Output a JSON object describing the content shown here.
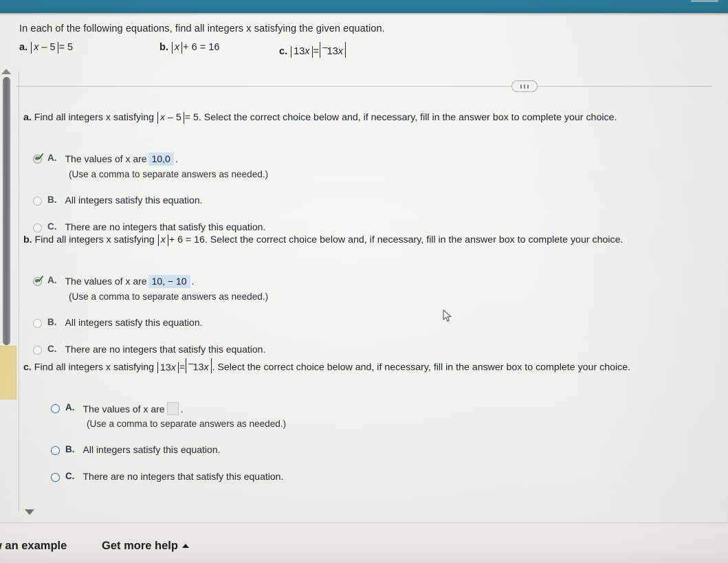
{
  "colors": {
    "header_teal": "#2b7c99",
    "answer_highlight": "#cfe0ee",
    "active_radio_blue": "#3b6ea8",
    "check_green": "#2e7d32",
    "sticky_note": "#e8d79a"
  },
  "prompt": "In each of the following equations, find all integers x satisfying the given equation.",
  "equation_list": [
    {
      "label": "a.",
      "expr": "|x − 5| = 5"
    },
    {
      "label": "b.",
      "expr": "|x| + 6 = 16"
    },
    {
      "label": "c.",
      "expr": "|13x| = |⁻13x|"
    }
  ],
  "divider": {
    "dots_label": "..."
  },
  "parts": [
    {
      "id": "part-a",
      "label": "a.",
      "question": "Find all integers x satisfying |x − 5| = 5. Select the correct choice below and, if necessary, fill in the answer box to complete your choice.",
      "state": "answered",
      "selected": "A",
      "choices": [
        {
          "letter": "A.",
          "text": "The values of x are",
          "answer_value": "10,0",
          "trailing": ".",
          "has_input": true,
          "selected": true,
          "checked": true
        },
        {
          "letter": "B.",
          "text": "All integers satisfy this equation.",
          "has_input": false,
          "selected": false,
          "checked": false
        },
        {
          "letter": "C.",
          "text": "There are no integers that satisfy this equation.",
          "has_input": false,
          "selected": false,
          "checked": false
        }
      ],
      "note": "(Use a comma to separate answers as needed.)"
    },
    {
      "id": "part-b",
      "label": "b.",
      "question": "Find all integers x satisfying |x| + 6 = 16. Select the correct choice below and, if necessary, fill in the answer box to complete your choice.",
      "state": "answered",
      "selected": "A",
      "choices": [
        {
          "letter": "A.",
          "text": "The values of x are",
          "answer_value": "10, − 10",
          "trailing": ".",
          "has_input": true,
          "selected": true,
          "checked": true
        },
        {
          "letter": "B.",
          "text": "All integers satisfy this equation.",
          "has_input": false,
          "selected": false,
          "checked": false
        },
        {
          "letter": "C.",
          "text": "There are no integers that satisfy this equation.",
          "has_input": false,
          "selected": false,
          "checked": false
        }
      ],
      "note": "(Use a comma to separate answers as needed.)"
    },
    {
      "id": "part-c",
      "label": "c.",
      "question": "Find all integers x satisfying |13x| = |⁻13x|. Select the correct choice below and, if necessary, fill in the answer box to complete your choice.",
      "state": "active",
      "selected": null,
      "choices": [
        {
          "letter": "A.",
          "text": "The values of x are",
          "answer_value": "",
          "trailing": ".",
          "has_input": true,
          "selected": false,
          "checked": false
        },
        {
          "letter": "B.",
          "text": "All integers satisfy this equation.",
          "has_input": false,
          "selected": false,
          "checked": false
        },
        {
          "letter": "C.",
          "text": "There are no integers that satisfy this equation.",
          "has_input": false,
          "selected": false,
          "checked": false
        }
      ],
      "note": "(Use a comma to separate answers as needed.)"
    }
  ],
  "bottom_bar": {
    "view_example_label": "w an example",
    "get_more_help_label": "Get more help"
  }
}
